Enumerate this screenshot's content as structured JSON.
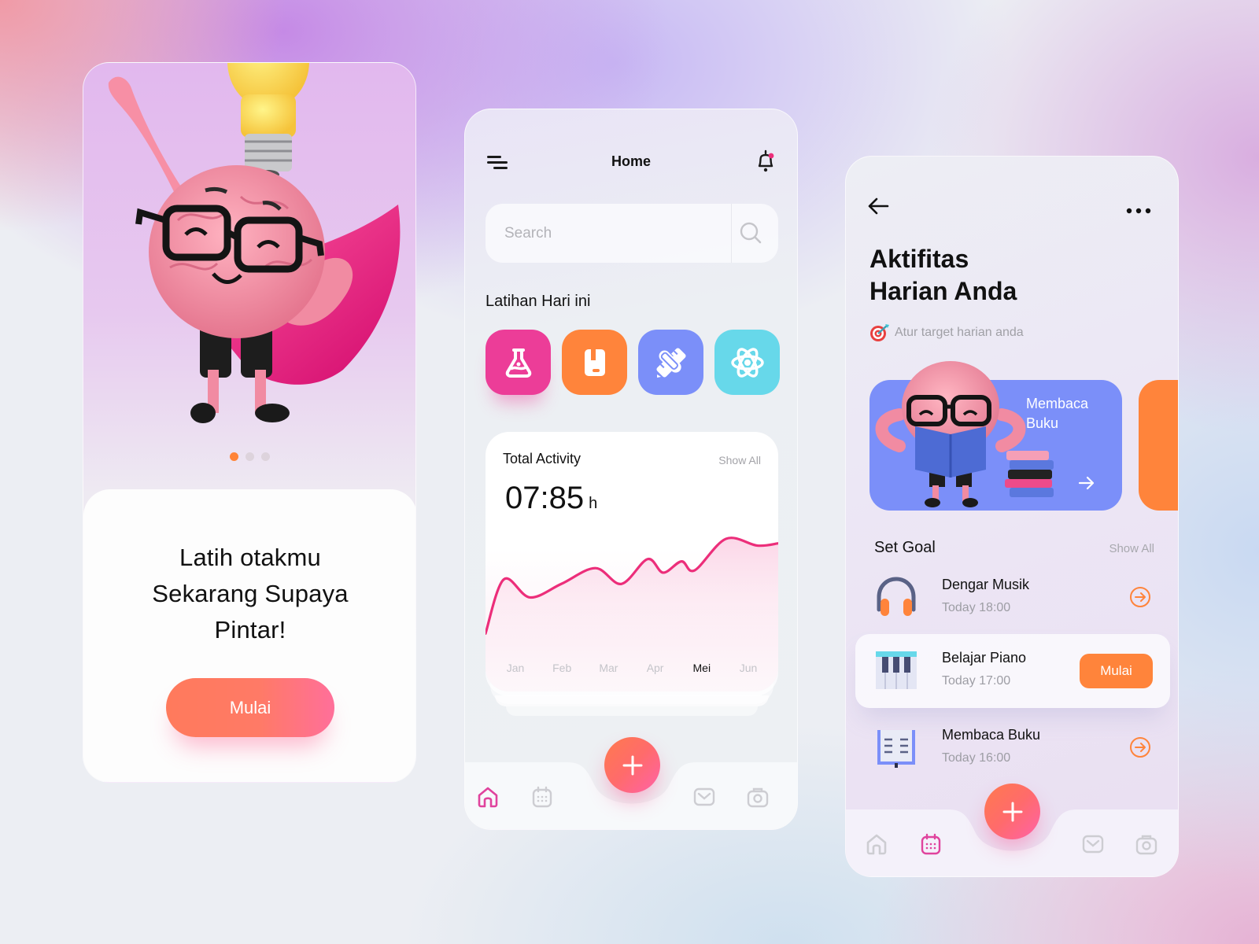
{
  "colors": {
    "accent_orange": "#ff843b",
    "accent_pink": "#ec3d98",
    "accent_blue": "#7b8ff9",
    "accent_cyan": "#67d8ea",
    "chart_line": "#ec2e7a",
    "notification_dot": "#ec2e7a"
  },
  "onboarding": {
    "illustration": "brain-superhero-lightbulb",
    "pager": {
      "count": 3,
      "active_index": 0
    },
    "headline": "Latih otakmu\nSekarang Supaya\nPintar!",
    "cta_label": "Mulai"
  },
  "home": {
    "title": "Home",
    "menu_icon": "menu-icon",
    "notification_icon": "bell-icon",
    "has_notification": true,
    "search": {
      "placeholder": "Search",
      "value": "",
      "icon": "search-icon"
    },
    "today_section": "Latihan Hari ini",
    "exercises": [
      {
        "name": "science",
        "icon": "flask-icon",
        "color": "#ec3d98"
      },
      {
        "name": "reading",
        "icon": "book-icon",
        "color": "#ff843b"
      },
      {
        "name": "drawing",
        "icon": "ruler-pencil-icon",
        "color": "#7b8ff9"
      },
      {
        "name": "physics",
        "icon": "atom-icon",
        "color": "#67d8ea"
      }
    ],
    "activity": {
      "title": "Total Activity",
      "show_all": "Show All",
      "value": "07:85",
      "unit": "h"
    },
    "nav": {
      "items": [
        "home",
        "calendar",
        "mail",
        "camera"
      ],
      "active": "home",
      "fab_label": "+"
    }
  },
  "chart_data": {
    "type": "area",
    "title": "Total Activity",
    "categories": [
      "Jan",
      "Feb",
      "Mar",
      "Apr",
      "Mei",
      "Jun"
    ],
    "highlighted_category": "Mei",
    "x": [
      0,
      0.35,
      0.85,
      1.45,
      2.1,
      2.6,
      3.1,
      3.4,
      3.75,
      4.0,
      4.6,
      5.2,
      5.6
    ],
    "values": [
      1.0,
      3.4,
      2.6,
      3.2,
      3.9,
      3.2,
      4.3,
      3.7,
      4.2,
      3.8,
      5.2,
      4.9,
      5.0
    ],
    "ylim": [
      0,
      6
    ],
    "xlim": [
      0,
      5.6
    ],
    "grid": false,
    "legend": "none",
    "xlabel": "",
    "ylabel": ""
  },
  "activities": {
    "back_icon": "arrow-left-icon",
    "more_icon": "more-dots-icon",
    "title": "Aktifitas\nHarian Anda",
    "subtitle": "Atur target harian anda",
    "subtitle_icon": "target-icon",
    "featured": {
      "label": "Membaca\nBuku",
      "illustration": "brain-reading-book",
      "arrow_icon": "arrow-right-icon"
    },
    "goals_title": "Set Goal",
    "goals_show_all": "Show All",
    "goals": [
      {
        "name": "Dengar Musik",
        "time": "Today 18:00",
        "icon": "headphones-icon",
        "action": "go"
      },
      {
        "name": "Belajar Piano",
        "time": "Today 17:00",
        "icon": "piano-icon",
        "action": "button",
        "button_label": "Mulai"
      },
      {
        "name": "Membaca Buku",
        "time": "Today 16:00",
        "icon": "book-open-icon",
        "action": "go"
      }
    ],
    "nav": {
      "items": [
        "home",
        "calendar",
        "mail",
        "camera"
      ],
      "active": "calendar",
      "fab_label": "+"
    }
  }
}
